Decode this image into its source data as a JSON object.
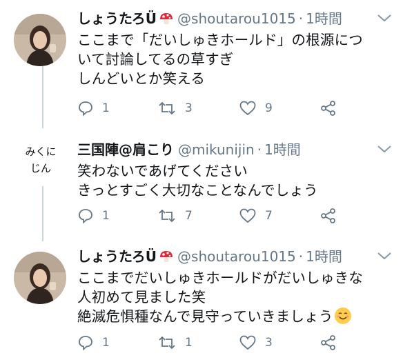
{
  "tweets": [
    {
      "name": "しょうたろÜ",
      "handle": "@shoutarou1015",
      "dot": "·",
      "time": "1時間",
      "lines": [
        "ここまで「だいしゅきホールド」の根源につ",
        "いて討論してるの草すぎ",
        "しんどいとか笑える"
      ],
      "replies": "1",
      "retweets": "3",
      "likes": "9"
    },
    {
      "avatar_text": [
        "みくに",
        "じん"
      ],
      "name": "三国陣@肩こり",
      "handle": "@mikunijin",
      "dot": "·",
      "time": "1時間",
      "lines": [
        "笑わないであげてください",
        "きっとすごく大切なことなんでしょう"
      ],
      "replies": "1",
      "retweets": "7",
      "likes": "7"
    },
    {
      "name": "しょうたろÜ",
      "handle": "@shoutarou1015",
      "dot": "·",
      "time": "1時間",
      "lines": [
        "ここまでだいしゅきホールドがだいしゅきな",
        "人初めて見ました笑",
        "絶滅危惧種なんで見守っていきましょう"
      ],
      "replies": "1",
      "retweets": "1",
      "likes": "3"
    }
  ],
  "colors": {
    "text": "#14171a",
    "muted": "#657786",
    "thread_line": "#ccd6dd"
  },
  "icons": [
    "mushroom-badge-icon",
    "reply-icon",
    "retweet-icon",
    "like-icon",
    "share-icon",
    "chevron-down-icon",
    "smiling-emoji-icon"
  ]
}
